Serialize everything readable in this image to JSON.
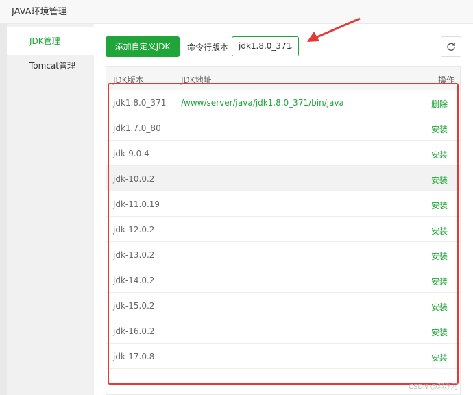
{
  "window": {
    "title": "JAVA环境管理"
  },
  "sidebar": {
    "items": [
      {
        "label": "JDK管理",
        "active": true
      },
      {
        "label": "Tomcat管理",
        "active": false
      }
    ]
  },
  "toolbar": {
    "add_label": "添加自定义JDK",
    "cli_label": "命令行版本",
    "cli_selected": "jdk1.8.0_371",
    "refresh_icon": "refresh-icon"
  },
  "table": {
    "headers": {
      "version": "JDK版本",
      "path": "JDK地址",
      "action": "操作"
    },
    "rows": [
      {
        "version": "jdk1.8.0_371",
        "path": "/www/server/java/jdk1.8.0_371/bin/java",
        "action": "删除"
      },
      {
        "version": "jdk1.7.0_80",
        "path": "",
        "action": "安装"
      },
      {
        "version": "jdk-9.0.4",
        "path": "",
        "action": "安装"
      },
      {
        "version": "jdk-10.0.2",
        "path": "",
        "action": "安装"
      },
      {
        "version": "jdk-11.0.19",
        "path": "",
        "action": "安装"
      },
      {
        "version": "jdk-12.0.2",
        "path": "",
        "action": "安装"
      },
      {
        "version": "jdk-13.0.2",
        "path": "",
        "action": "安装"
      },
      {
        "version": "jdk-14.0.2",
        "path": "",
        "action": "安装"
      },
      {
        "version": "jdk-15.0.2",
        "path": "",
        "action": "安装"
      },
      {
        "version": "jdk-16.0.2",
        "path": "",
        "action": "安装"
      },
      {
        "version": "jdk-17.0.8",
        "path": "",
        "action": "安装"
      }
    ]
  },
  "watermark": "CSDN @邓浮河",
  "colors": {
    "accent": "#20a53a",
    "annotation": "#e53935"
  }
}
